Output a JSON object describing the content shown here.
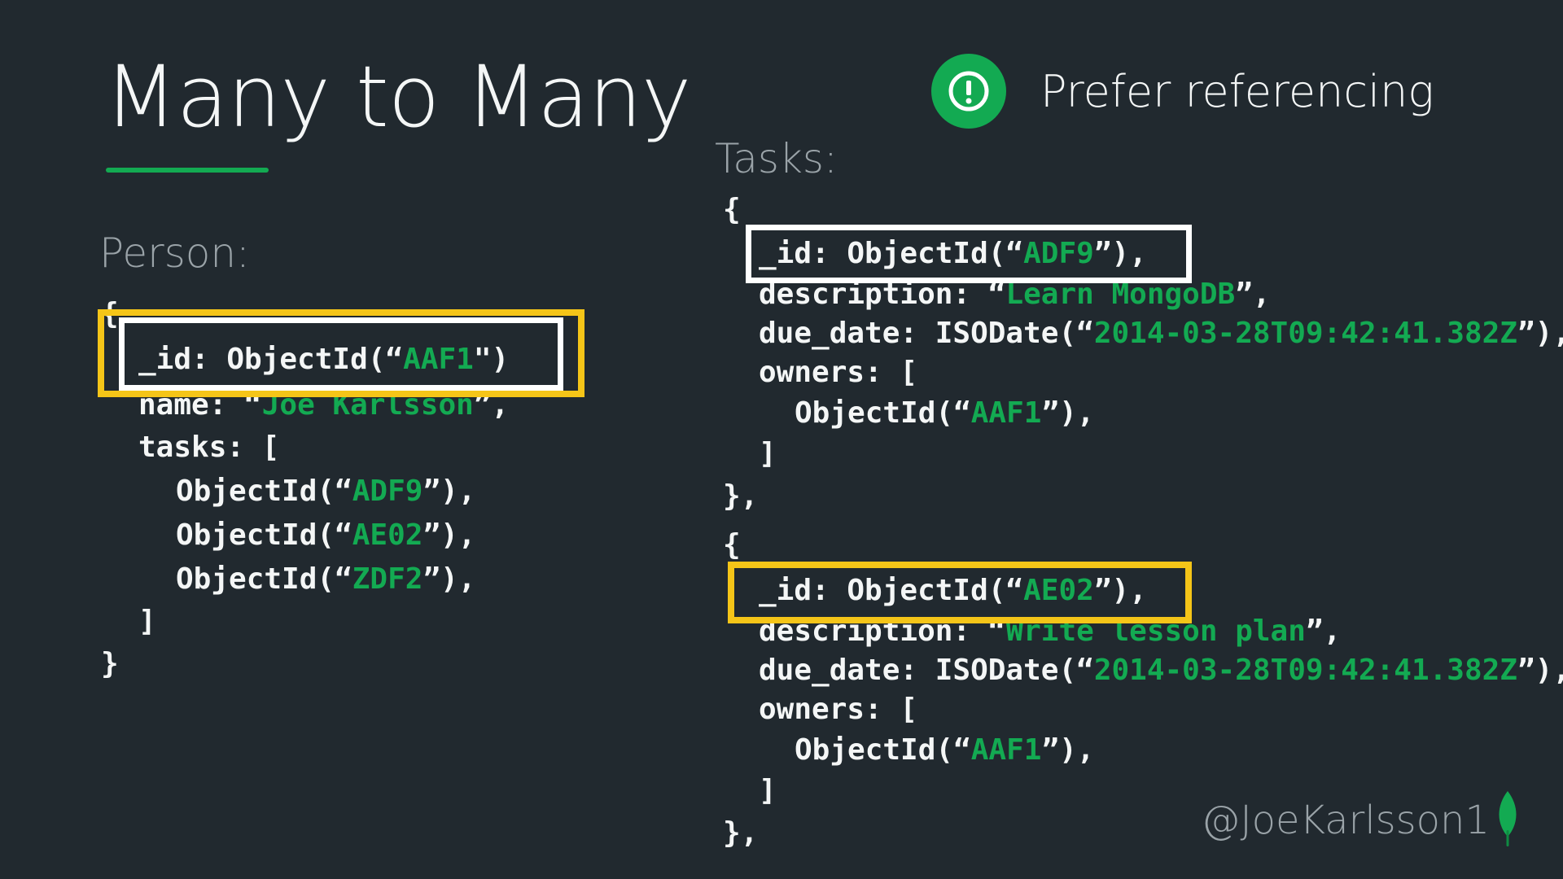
{
  "slide": {
    "title": "Many to Many",
    "callout": {
      "text": "Prefer referencing",
      "icon": "exclamation-circle-icon"
    },
    "footer": {
      "handle": "@JoeKarlsson1",
      "logo_icon": "mongodb-leaf-icon"
    }
  },
  "colors": {
    "background": "#21292f",
    "accent_green": "#13aa52",
    "highlight_yellow": "#f5c518",
    "highlight_white": "#ffffff"
  },
  "person": {
    "label": "Person:",
    "open": "{",
    "id_key": "_id: ObjectId(“",
    "id_value": "AAF1",
    "id_close": "\")",
    "name_key": "name: “",
    "name_value": "Joe Karlsson",
    "name_close": "”,",
    "tasks_key": "tasks: [",
    "tasks": [
      {
        "pre": "ObjectId(“",
        "value": "ADF9",
        "post": "”),"
      },
      {
        "pre": "ObjectId(“",
        "value": "AE02",
        "post": "”),"
      },
      {
        "pre": "ObjectId(“",
        "value": "ZDF2",
        "post": "”),"
      }
    ],
    "tasks_close": "]",
    "close": "}"
  },
  "tasks": {
    "label": "Tasks:",
    "documents": [
      {
        "open": "{",
        "id_key": "_id: ObjectId(“",
        "id_value": "ADF9",
        "id_close": "”),",
        "desc_key": "description: “",
        "desc_value": "Learn MongoDB",
        "desc_close": "”,",
        "due_key": "due_date: ISODate(“",
        "due_value": "2014-03-28T09:42:41.382Z",
        "due_close": "”),",
        "owners_key": "owners: [",
        "owner_pre": "ObjectId(“",
        "owner_value": "AAF1",
        "owner_post": "”),",
        "owners_close": "]",
        "close": "},"
      },
      {
        "open": "{",
        "id_key": "_id: ObjectId(“",
        "id_value": "AE02",
        "id_close": "”),",
        "desc_key": "description: “",
        "desc_value": "Write lesson plan",
        "desc_close": "”,",
        "due_key": "due_date: ISODate(“",
        "due_value": "2014-03-28T09:42:41.382Z",
        "due_close": "”),",
        "owners_key": "owners: [",
        "owner_pre": "ObjectId(“",
        "owner_value": "AAF1",
        "owner_post": "”),",
        "owners_close": "]",
        "close": "},"
      }
    ]
  }
}
